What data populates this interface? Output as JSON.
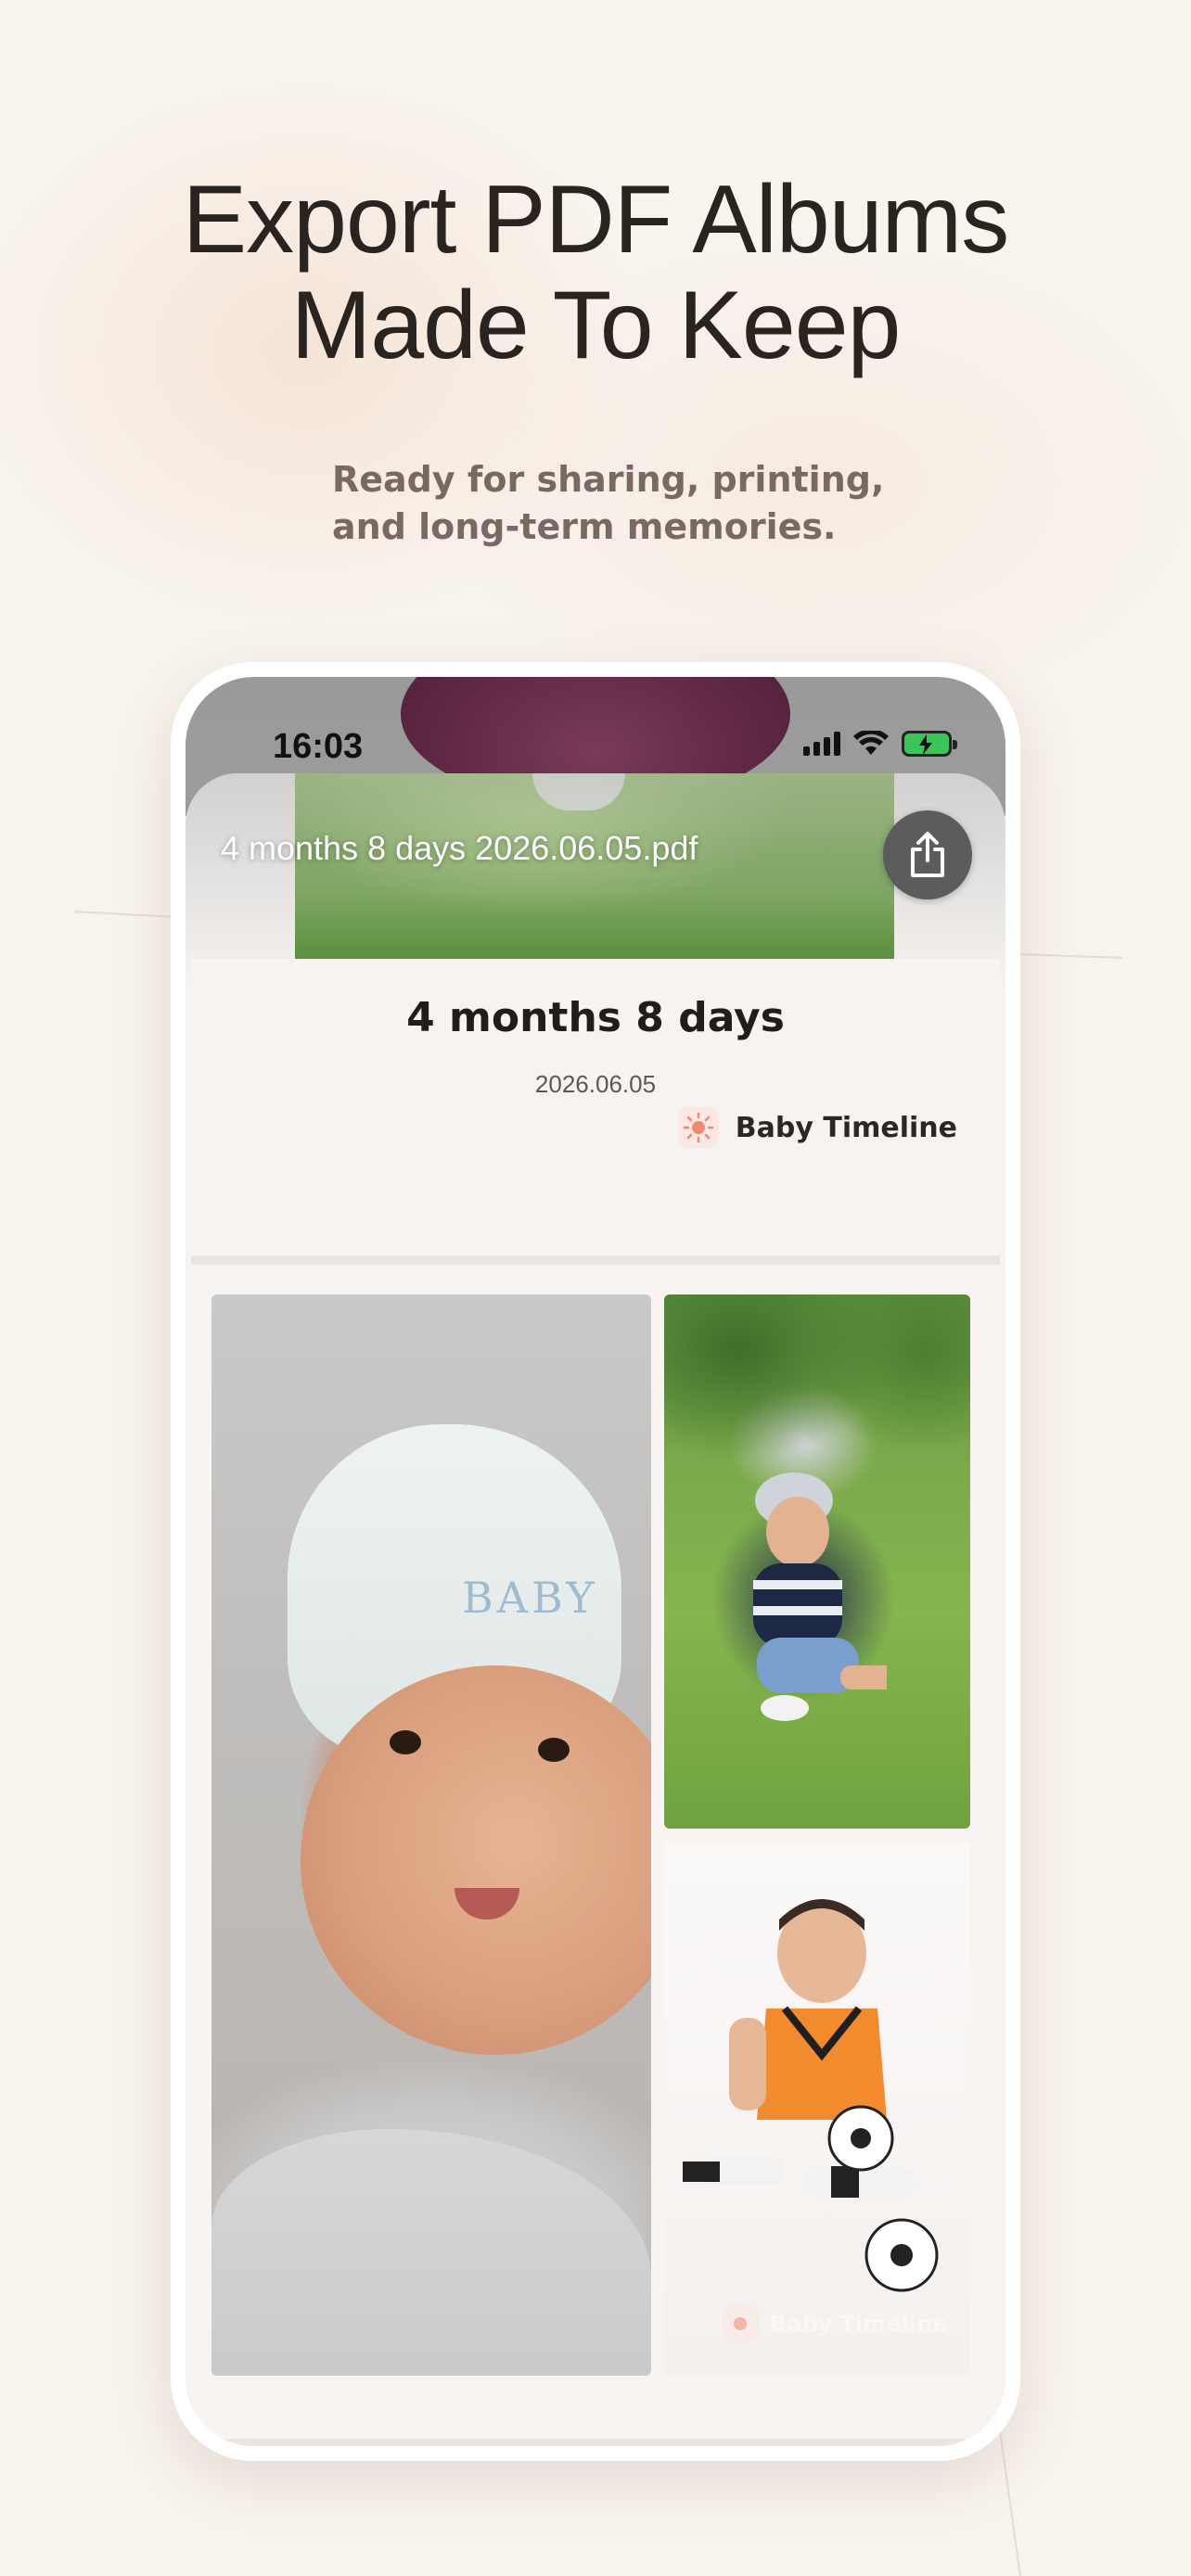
{
  "marketing": {
    "headline_line1": "Export PDF Albums",
    "headline_line2": "Made To Keep",
    "subline_line1": "Ready for sharing, printing,",
    "subline_line2": "and long-term memories."
  },
  "status_bar": {
    "time": "16:03",
    "icons": [
      "cellular-signal-icon",
      "wifi-icon",
      "battery-charging-icon"
    ],
    "battery_color": "#3bc45a"
  },
  "viewer": {
    "file_name": "4 months 8 days 2026.06.05.pdf",
    "share_icon": "share-icon"
  },
  "album_page": {
    "age_title": "4 months 8 days",
    "date": "2026.06.05",
    "brand_name": "Baby Timeline",
    "brand_icon": "sun-icon",
    "hat_text": "BABY",
    "watermark_text": "Baby Timeline"
  },
  "colors": {
    "background": "#f8f3ed",
    "headline": "#2a2421",
    "subline": "#7a6962",
    "brand_accent": "#ef8a72"
  }
}
